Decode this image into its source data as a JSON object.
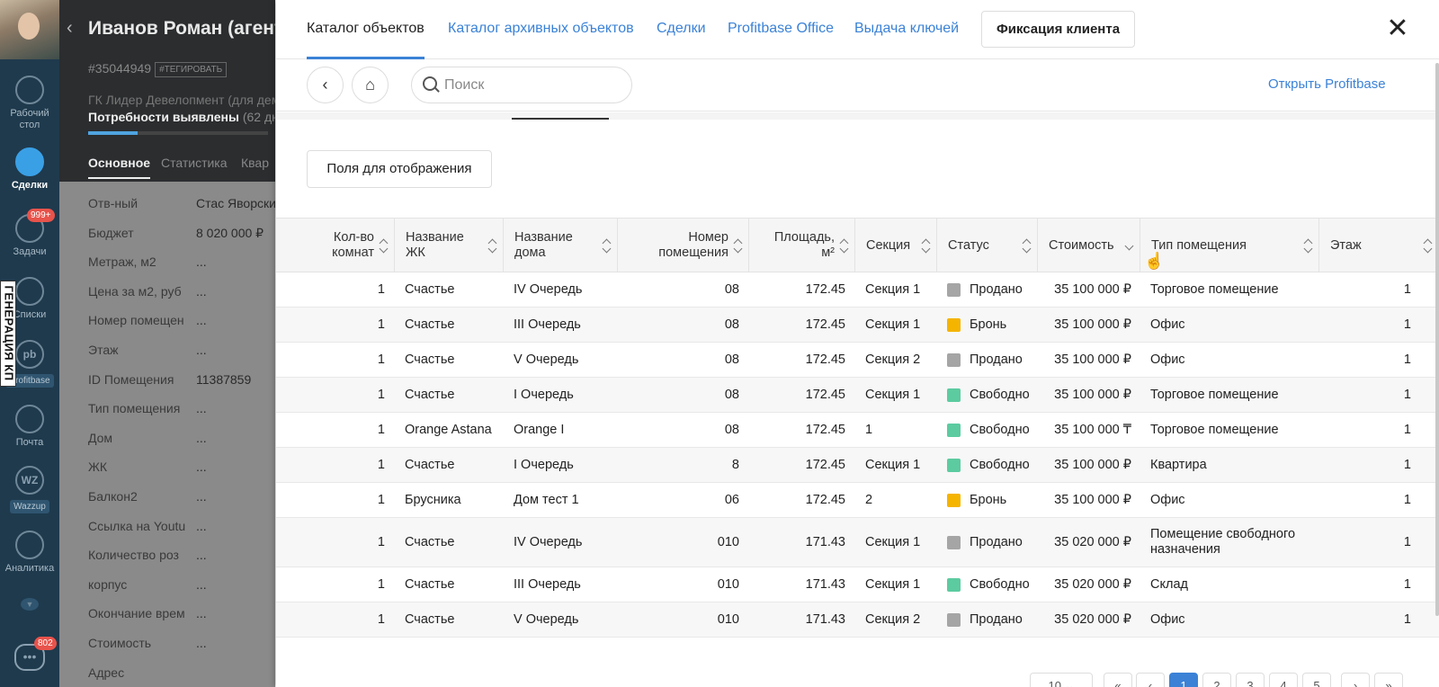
{
  "leftnav": {
    "items": [
      {
        "label": "Рабочий стол",
        "icon": "dashboard-icon"
      },
      {
        "label": "Сделки",
        "icon": "deals-icon"
      },
      {
        "label": "Задачи",
        "icon": "tasks-icon",
        "badge": "999+"
      },
      {
        "label": "Списки",
        "icon": "lists-icon"
      },
      {
        "label": "Profitbase",
        "icon": "profitbase-icon",
        "pill": "Profitbase",
        "logo": "pb"
      },
      {
        "label": "Почта",
        "icon": "mail-icon"
      },
      {
        "label": "Wazzup",
        "icon": "wazzup-icon",
        "pill": "Wazzup",
        "logo": "WZ"
      },
      {
        "label": "Аналитика",
        "icon": "analytics-icon"
      }
    ],
    "chat_badge": "802",
    "kp_tab": "ГЕНЕРАЦИЯ КП"
  },
  "deal": {
    "title": "Иванов Роман (агент",
    "number": "#35044949",
    "tag": "#ТЕГИРОВАТЬ",
    "company": "ГК Лидер Девелопмент (для демо",
    "stage": "Потребности выявлены",
    "stage_days": "(62 дн",
    "tabs": [
      "Основное",
      "Статистика",
      "Квар"
    ],
    "fields": [
      {
        "label": "Отв-ный",
        "value": "Стас Яворски"
      },
      {
        "label": "Бюджет",
        "value": "8 020 000 ₽"
      },
      {
        "label": "Метраж, м2",
        "value": "..."
      },
      {
        "label": "Цена за м2, руб",
        "value": "..."
      },
      {
        "label": "Номер помещен",
        "value": "..."
      },
      {
        "label": "Этаж",
        "value": "..."
      },
      {
        "label": "ID Помещения",
        "value": "11387859"
      },
      {
        "label": "Тип помещения",
        "value": "..."
      },
      {
        "label": "Дом",
        "value": "..."
      },
      {
        "label": "ЖК",
        "value": "..."
      },
      {
        "label": "Балкон2",
        "value": "..."
      },
      {
        "label": "Ссылка на Youtu",
        "value": "..."
      },
      {
        "label": "Количество роз",
        "value": "..."
      },
      {
        "label": "корпус",
        "value": "..."
      },
      {
        "label": "Окончание врем",
        "value": "..."
      },
      {
        "label": "Стоимость",
        "value": "..."
      },
      {
        "label": "Адрес",
        "value": ""
      }
    ]
  },
  "modal": {
    "tabs": [
      "Каталог объектов",
      "Каталог архивных объектов",
      "Сделки",
      "Profitbase Office",
      "Выдача ключей"
    ],
    "fix_client": "Фиксация клиента",
    "close": "✕",
    "search_placeholder": "Поиск",
    "open_profitbase": "Открыть Profitbase",
    "fields_button": "Поля для отображения"
  },
  "table": {
    "columns": [
      "Кол-во комнат",
      "Название ЖК",
      "Название дома",
      "Номер помещения",
      "Площадь, м²",
      "Секция",
      "Статус",
      "Стоимость",
      "Тип помещения",
      "Этаж"
    ],
    "status_colors": {
      "Продано": "#a5a5a5",
      "Бронь": "#f5b400",
      "Свободно": "#5ccba0"
    },
    "rows": [
      [
        "1",
        "Счастье",
        "IV Очередь",
        "08",
        "172.45",
        "Секция 1",
        "Продано",
        "35 100 000 ₽",
        "Торговое помещение",
        "1"
      ],
      [
        "1",
        "Счастье",
        "III Очередь",
        "08",
        "172.45",
        "Секция 1",
        "Бронь",
        "35 100 000 ₽",
        "Офис",
        "1"
      ],
      [
        "1",
        "Счастье",
        "V Очередь",
        "08",
        "172.45",
        "Секция 2",
        "Продано",
        "35 100 000 ₽",
        "Офис",
        "1"
      ],
      [
        "1",
        "Счастье",
        "I Очередь",
        "08",
        "172.45",
        "Секция 1",
        "Свободно",
        "35 100 000 ₽",
        "Торговое помещение",
        "1"
      ],
      [
        "1",
        "Orange Astana",
        "Orange I",
        "08",
        "172.45",
        "1",
        "Свободно",
        "35 100 000 ₸",
        "Торговое помещение",
        "1"
      ],
      [
        "1",
        "Счастье",
        "I Очередь",
        "8",
        "172.45",
        "Секция 1",
        "Свободно",
        "35 100 000 ₽",
        "Квартира",
        "1"
      ],
      [
        "1",
        "Брусника",
        "Дом тест 1",
        "06",
        "172.45",
        "2",
        "Бронь",
        "35 100 000 ₽",
        "Офис",
        "1"
      ],
      [
        "1",
        "Счастье",
        "IV Очередь",
        "010",
        "171.43",
        "Секция 1",
        "Продано",
        "35 020 000 ₽",
        "Помещение свободного назначения",
        "1"
      ],
      [
        "1",
        "Счастье",
        "III Очередь",
        "010",
        "171.43",
        "Секция 1",
        "Свободно",
        "35 020 000 ₽",
        "Склад",
        "1"
      ],
      [
        "1",
        "Счастье",
        "V Очередь",
        "010",
        "171.43",
        "Секция 2",
        "Продано",
        "35 020 000 ₽",
        "Офис",
        "1"
      ]
    ]
  },
  "pagination": {
    "per_page": "10",
    "pages": [
      "1",
      "2",
      "3",
      "4",
      "5"
    ],
    "current": "1"
  }
}
